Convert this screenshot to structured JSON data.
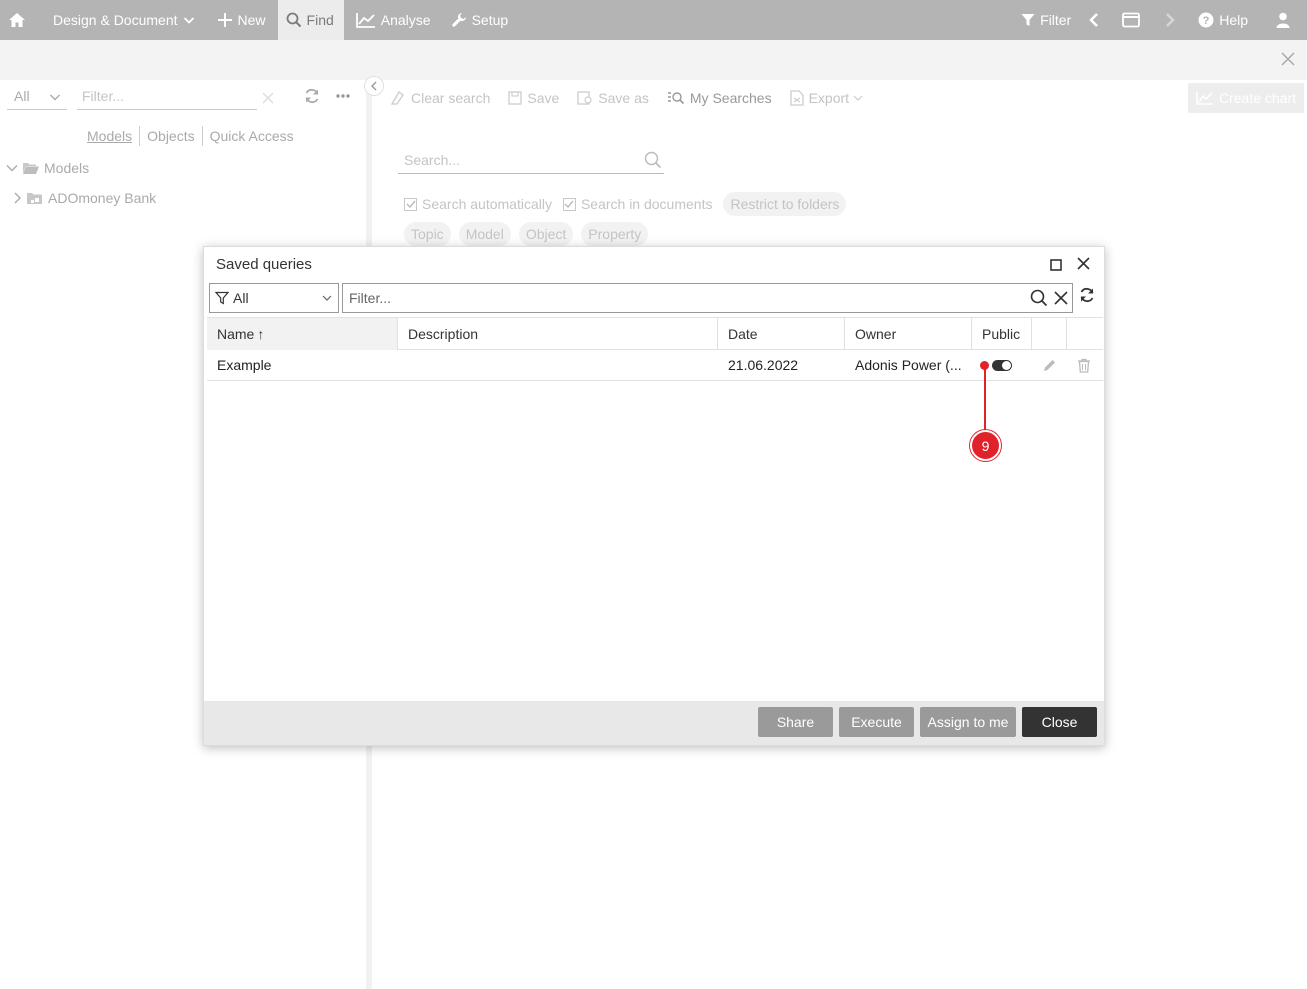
{
  "topbar": {
    "design_document": "Design & Document",
    "new": "New",
    "find": "Find",
    "analyse": "Analyse",
    "setup": "Setup",
    "filter": "Filter",
    "help": "Help"
  },
  "left_panel": {
    "select_value": "All",
    "filter_placeholder": "Filter...",
    "tabs": [
      "Models",
      "Objects",
      "Quick Access"
    ],
    "tree": {
      "root": "Models",
      "child": "ADOmoney Bank"
    }
  },
  "main": {
    "toolbar": {
      "clear_search": "Clear search",
      "save": "Save",
      "save_as": "Save as",
      "my_searches": "My Searches",
      "export": "Export"
    },
    "create_chart": "Create chart",
    "search_placeholder": "Search...",
    "search_automatically": "Search automatically",
    "search_in_documents": "Search in documents",
    "restrict_to_folders": "Restrict to folders",
    "pills": [
      "Topic",
      "Model",
      "Object",
      "Property"
    ]
  },
  "dialog": {
    "title": "Saved queries",
    "select_value": "All",
    "filter_placeholder": "Filter...",
    "columns": {
      "name": "Name",
      "name_sort": "↑",
      "description": "Description",
      "date": "Date",
      "owner": "Owner",
      "public": "Public"
    },
    "rows": [
      {
        "name": "Example",
        "description": "",
        "date": "21.06.2022",
        "owner": "Adonis Power (...",
        "public": true
      }
    ],
    "footer": {
      "share": "Share",
      "execute": "Execute",
      "assign_to_me": "Assign to me",
      "close": "Close"
    }
  },
  "annotation": {
    "number": "9",
    "color": "#e0232a"
  },
  "colors": {
    "topbar_bg": "#b4b4b4",
    "close_button": "#333333",
    "footer_button": "#9a9a9a"
  }
}
